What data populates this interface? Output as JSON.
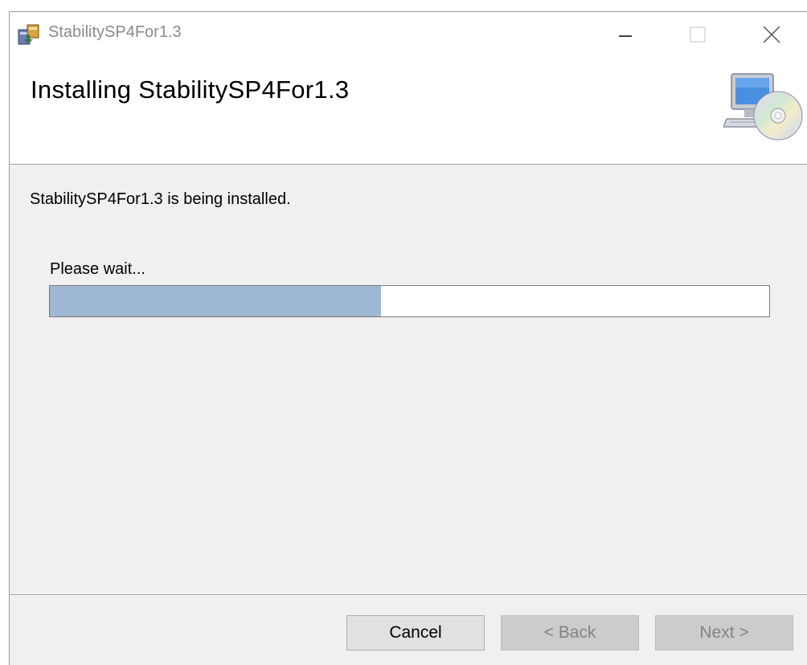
{
  "window": {
    "title": "StabilitySP4For1.3"
  },
  "header": {
    "title": "Installing StabilitySP4For1.3",
    "icon": "computer-cd-icon"
  },
  "body": {
    "status": "StabilitySP4For1.3 is being installed.",
    "wait_label": "Please wait...",
    "progress_fraction": 0.46
  },
  "buttons": {
    "cancel": "Cancel",
    "back": "< Back",
    "next": "Next >"
  },
  "colors": {
    "progress_fill": "#9fb8d3",
    "window_bg": "#f0f0f0",
    "title_text": "#8a8a8a"
  }
}
